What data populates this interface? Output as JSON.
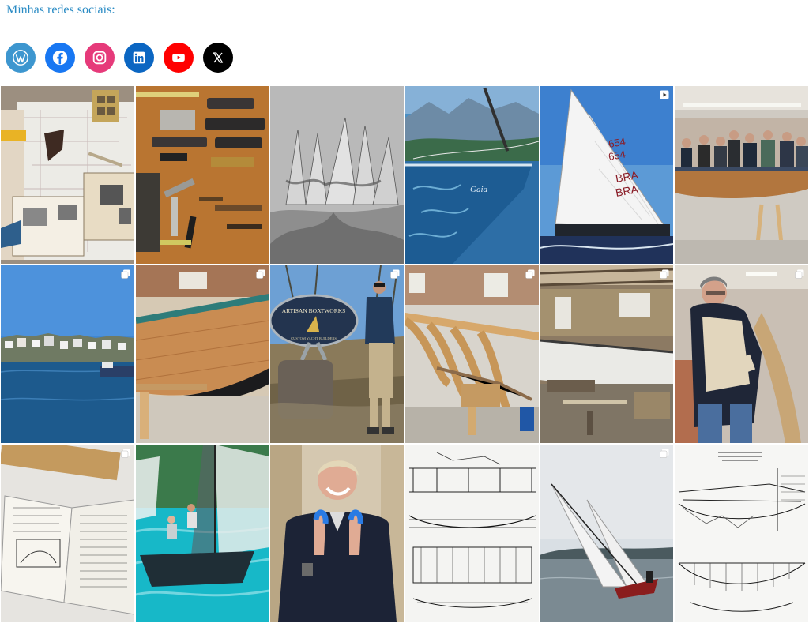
{
  "header": {
    "title": "Minhas redes sociais:"
  },
  "social_links": [
    {
      "name": "wordpress",
      "icon": "wordpress-icon",
      "color": "#3d96cf"
    },
    {
      "name": "facebook",
      "icon": "facebook-icon",
      "color": "#1877f2"
    },
    {
      "name": "instagram",
      "icon": "instagram-icon",
      "color": "#e63a7a"
    },
    {
      "name": "linkedin",
      "icon": "linkedin-icon",
      "color": "#0b66c2"
    },
    {
      "name": "youtube",
      "icon": "youtube-icon",
      "color": "#ff0000"
    },
    {
      "name": "x",
      "icon": "x-icon",
      "color": "#000000"
    }
  ],
  "gallery": {
    "tiles": [
      {
        "subject": "Desk with boat plans, tools and books",
        "badge": "none"
      },
      {
        "subject": "Woodworking hand planes on a bench",
        "badge": "none"
      },
      {
        "subject": "Black and white sailboats with shadows",
        "badge": "none"
      },
      {
        "subject": "Bow of a blue boat at sea with mountains",
        "badge": "none",
        "text": "Gaia"
      },
      {
        "subject": "White sail with sail numbers",
        "badge": "video",
        "text": [
          "BRA",
          "BRA",
          "654",
          "654"
        ]
      },
      {
        "subject": "Group of men behind a wooden boat in workshop",
        "badge": "none"
      },
      {
        "subject": "Harbor with waterfront town",
        "badge": "carousel"
      },
      {
        "subject": "Wooden boat hull in workshop",
        "badge": "carousel"
      },
      {
        "subject": "Man beside Artisan Boatworks sign",
        "badge": "carousel",
        "text": [
          "ARTISAN BOATWORKS",
          "CUSTOM YACHT BUILDERS"
        ]
      },
      {
        "subject": "Wooden boat frames under construction",
        "badge": "carousel"
      },
      {
        "subject": "Large hull in a boatbuilding shed",
        "badge": "carousel"
      },
      {
        "subject": "Man planing a curved wooden frame",
        "badge": "carousel"
      },
      {
        "subject": "Open book with boat drawings",
        "badge": "carousel"
      },
      {
        "subject": "Racing sailboats with crew",
        "badge": "none"
      },
      {
        "subject": "Smiling man holding blue parts",
        "badge": "none"
      },
      {
        "subject": "Technical boat plan drawing",
        "badge": "none"
      },
      {
        "subject": "Sailboat heeling on grey water",
        "badge": "carousel"
      },
      {
        "subject": "International Dragon Class plan drawing",
        "badge": "none"
      }
    ]
  }
}
